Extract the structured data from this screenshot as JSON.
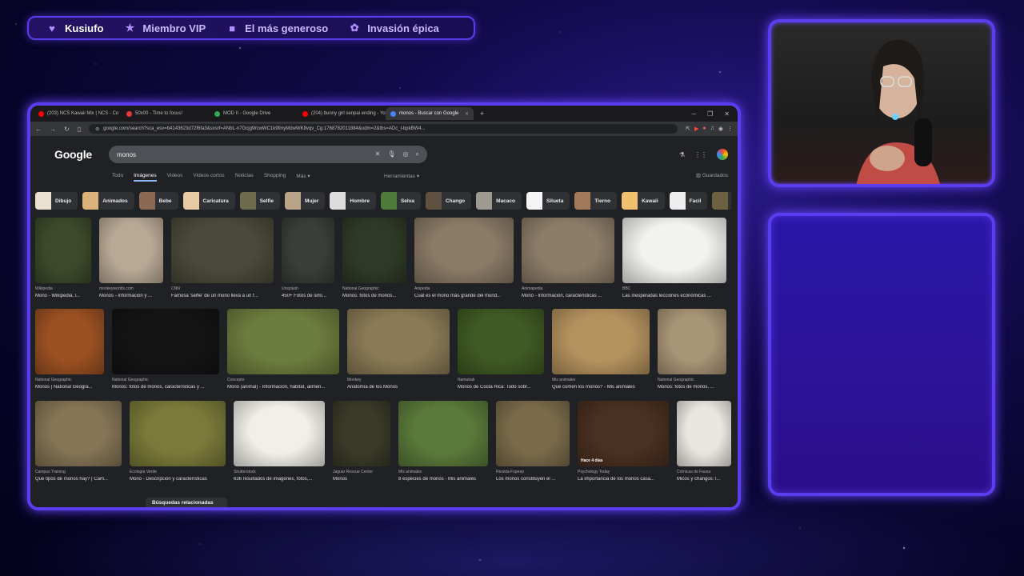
{
  "alerts_bar": {
    "items": [
      {
        "icon": "heart-icon",
        "glyph": "♥",
        "label": "Kusiufo"
      },
      {
        "icon": "star-icon",
        "glyph": "★",
        "label": "Miembro VIP"
      },
      {
        "icon": "gift-icon",
        "glyph": "■",
        "label": "El más generoso"
      },
      {
        "icon": "paw-icon",
        "glyph": "✿",
        "label": "Invasión épica"
      }
    ]
  },
  "browser": {
    "tabs": [
      {
        "label": "(203) NCS Kawaii Mix | NCS - Co",
        "favicon_color": "#ff0000",
        "active": false
      },
      {
        "label": "50x00 - Time to focus!",
        "favicon_color": "#e53935",
        "active": false
      },
      {
        "label": "MOD II - Google Drive",
        "favicon_color": "#34a853",
        "active": false
      },
      {
        "label": "(204) bunny girl senpai ending - You",
        "favicon_color": "#ff0000",
        "active": false
      },
      {
        "label": "monos - Buscar con Google",
        "favicon_color": "#4285f4",
        "active": true
      }
    ],
    "url": "google.com/search?sca_esv=b4143623d72f6fa3&sxsrf=ANbL-n7GcjgWcwWC1k9fmyMdwWK8vqv_Cg:1768782011884&udm=2&tbs=ADc_l-bpkBW4..."
  },
  "google": {
    "logo": "Google",
    "query": "monos",
    "tabs": [
      "Todo",
      "Imágenes",
      "Videos",
      "Videos cortos",
      "Noticias",
      "Shopping",
      "Más ▾"
    ],
    "tools_label": "Herramientas ▾",
    "saved_label": "Guardados",
    "chips": [
      {
        "label": "Dibujo",
        "color": "#e9e0d0"
      },
      {
        "label": "Animados",
        "color": "#d9b37a"
      },
      {
        "label": "Bebe",
        "color": "#8a6a55"
      },
      {
        "label": "Caricatura",
        "color": "#e7c9a2"
      },
      {
        "label": "Selfie",
        "color": "#6d6a4e"
      },
      {
        "label": "Mujer",
        "color": "#b9a48a"
      },
      {
        "label": "Hombre",
        "color": "#ddd"
      },
      {
        "label": "Selva",
        "color": "#4f7a3a"
      },
      {
        "label": "Chango",
        "color": "#5f5040"
      },
      {
        "label": "Macaco",
        "color": "#9e9a92"
      },
      {
        "label": "Silueta",
        "color": "#f5f5f5"
      },
      {
        "label": "Tierno",
        "color": "#a27a5a"
      },
      {
        "label": "Kawaii",
        "color": "#f0c070"
      },
      {
        "label": "Facil",
        "color": "#eeeeee"
      },
      {
        "label": "",
        "color": "#6b6040"
      }
    ],
    "rows": [
      [
        {
          "source": "Wikipedia",
          "caption": "Mono - Wikipedia, l...",
          "color": "#3c4a2a",
          "w": 70
        },
        {
          "source": "monkeyworlds.com",
          "caption": "Monos - Información y ...",
          "color": "#b8a995",
          "w": 80
        },
        {
          "source": "CNN",
          "caption": "Famosa 'selfie' de un mono lleva a un f...",
          "color": "#4b4a3a",
          "w": 128
        },
        {
          "source": "Unsplash",
          "caption": "450+ Fotos de simi...",
          "color": "#3a3d38",
          "w": 66
        },
        {
          "source": "National Geographic",
          "caption": "Monos: fotos de monos...",
          "color": "#2f3a26",
          "w": 80
        },
        {
          "source": "Anipedia",
          "caption": "Cuál es el mono más grande del mund...",
          "color": "#8a7a66",
          "w": 124
        },
        {
          "source": "Animapedia",
          "caption": "Mono - Información, características ...",
          "color": "#8c7d68",
          "w": 116
        },
        {
          "source": "BBC",
          "caption": "Las inesperadas lecciones económicas ...",
          "color": "#f2f2f0",
          "w": 130
        }
      ],
      [
        {
          "source": "National Geographic",
          "caption": "Monos | National Geogra...",
          "color": "#9a5022",
          "w": 86
        },
        {
          "source": "National Geographic",
          "caption": "Monos: fotos de monos, características y ...",
          "color": "#141414",
          "w": 134
        },
        {
          "source": "Concepto",
          "caption": "Mono (animal) - Información, hábitat, alimen...",
          "color": "#6d7d3e",
          "w": 140
        },
        {
          "source": "Monkey",
          "caption": "Anatomía de los Monos",
          "color": "#8a7a56",
          "w": 128
        },
        {
          "source": "Namubak",
          "caption": "Monos de Costa Rica: Todo sobr...",
          "color": "#3f5a24",
          "w": 108
        },
        {
          "source": "Mis animales",
          "caption": "Qué comen los monos? - Mis animales",
          "color": "#b4925e",
          "w": 122
        },
        {
          "source": "National Geographic",
          "caption": "Monos: fotos de monos, ...",
          "color": "#a89476",
          "w": 86
        }
      ],
      [
        {
          "source": "Campus Training",
          "caption": "Qué tipos de monos hay? | Cam...",
          "color": "#857455",
          "w": 108
        },
        {
          "source": "Ecología Verde",
          "caption": "Mono - Descripción y características",
          "color": "#7a7a3a",
          "w": 120
        },
        {
          "source": "Shutterstock",
          "caption": "636 resultados de imágenes, fotos,...",
          "color": "#f1efe9",
          "w": 114
        },
        {
          "source": "Jaguar Rescue Center",
          "caption": "Monos",
          "color": "#3a3a28",
          "w": 72
        },
        {
          "source": "Mis animales",
          "caption": "8 especies de monos - Mis animales",
          "color": "#5a7a3a",
          "w": 112
        },
        {
          "source": "Revista Fopeep",
          "caption": "Los monos constituyen el ...",
          "color": "#7a6a4a",
          "w": 92
        },
        {
          "source": "Psychology Today",
          "caption": "La importancia de los monos casa...",
          "color": "#4a3020",
          "w": 114
        },
        {
          "source": "Crónicas de Fauna",
          "caption": "Micos y changos: l...",
          "color": "#e9e6e0",
          "w": 68
        }
      ]
    ],
    "row3_badge": "Hace 4 días",
    "related_label": "Búsquedas relacionadas"
  }
}
